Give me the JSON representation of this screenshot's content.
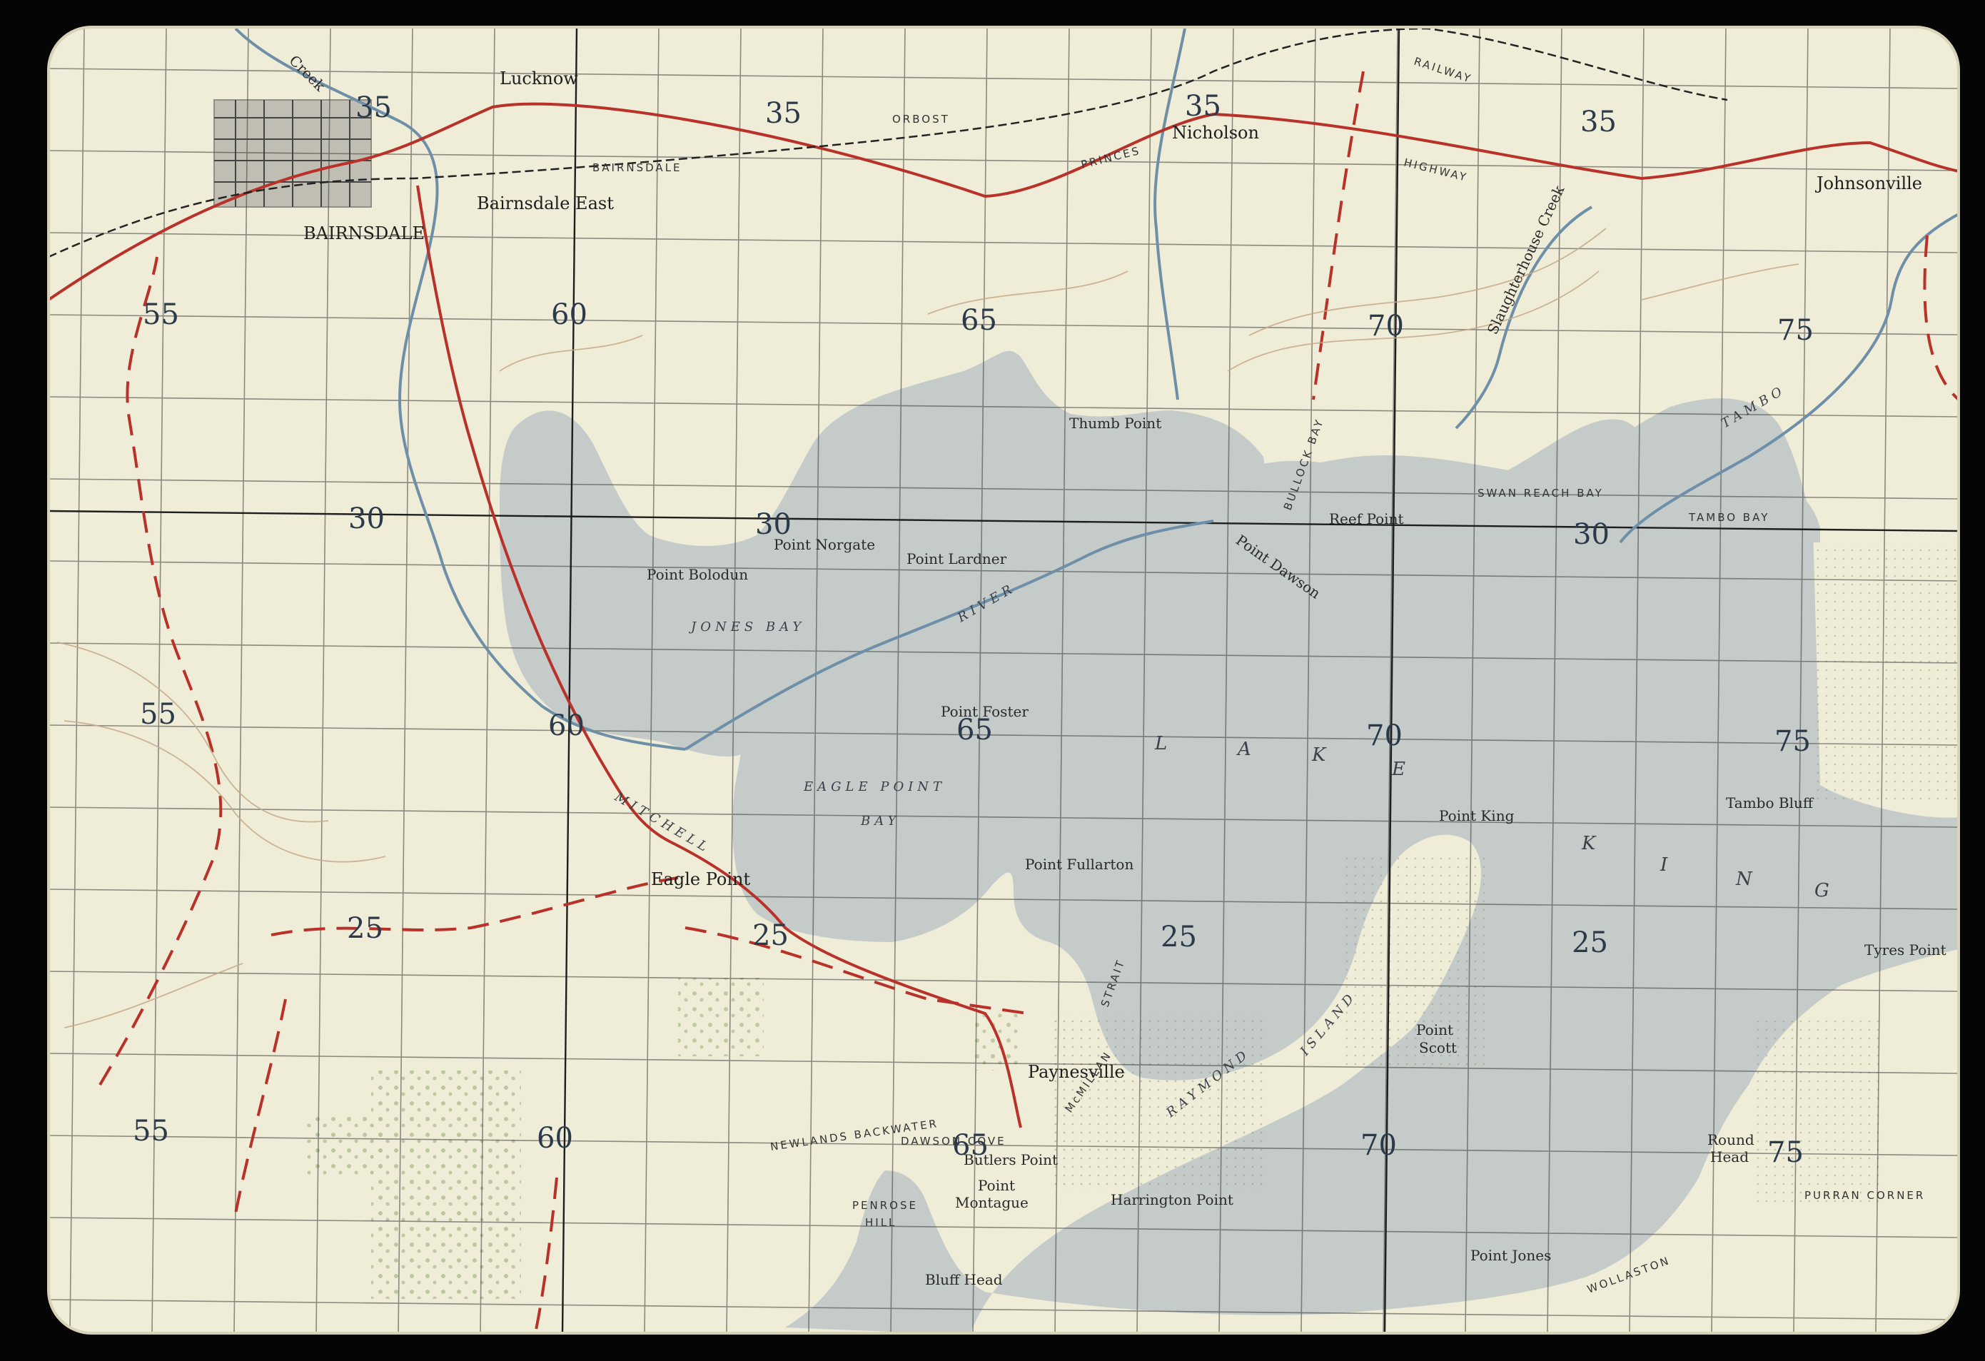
{
  "map": {
    "colors": {
      "paper": "#efecd7",
      "water": "#c4cbc9",
      "grid": "#3a3a3a",
      "road": "#b8322a",
      "contour": "#c7a98a",
      "vegetation": "#b8c49a"
    },
    "towns": {
      "lucknow": "Lucknow",
      "bairnsdale": "BAIRNSDALE",
      "bairnsdale_east": "Bairnsdale East",
      "nicholson": "Nicholson",
      "johnsonville": "Johnsonville",
      "eagle_point": "Eagle Point",
      "paynesville": "Paynesville"
    },
    "places": {
      "thumb_point": "Thumb Point",
      "point_norgate": "Point Norgate",
      "point_bolodun": "Point Bolodun",
      "point_lardner": "Point Lardner",
      "point_dawson": "Point Dawson",
      "reef_point": "Reef Point",
      "point_foster": "Point Foster",
      "point_fullarton": "Point Fullarton",
      "point_king": "Point King",
      "tambo_bluff": "Tambo Bluff",
      "tyres_point": "Tyres Point",
      "point_scott_1": "Point",
      "point_scott_2": "Scott",
      "round_head_1": "Round",
      "round_head_2": "Head",
      "butlers_point": "Butlers Point",
      "point_montague_1": "Point",
      "point_montague_2": "Montague",
      "harrington_point": "Harrington Point",
      "point_jones": "Point Jones",
      "bluff_head": "Bluff Head",
      "penrose_hill_1": "PENROSE",
      "penrose_hill_2": "HILL",
      "newlands_backwater": "NEWLANDS  BACKWATER",
      "dawson_cove": "DAWSON COVE",
      "purran_corner": "PURRAN CORNER",
      "wollaston": "WOLLASTON"
    },
    "water_bodies": {
      "jones_bay": "JONES   BAY",
      "eagle_point_1": "EAGLE    POINT",
      "eagle_point_2": "BAY",
      "swan_reach_bay": "SWAN  REACH  BAY",
      "tambo_bay": "TAMBO  BAY",
      "lake_king_letters": [
        "L",
        "A",
        "K",
        "E",
        "K",
        "I",
        "N",
        "G"
      ],
      "mitchell": "MITCHELL",
      "river": "RIVER",
      "tambo": "TAMBO",
      "creek": "Creek",
      "slaughterhouse_creek": "Slaughterhouse Creek",
      "straits": "STRAIT",
      "mcmillan": "McMILLAN",
      "bullock_bay": "BULLOCK BAY"
    },
    "roads": {
      "princes": "PRINCES",
      "highway": "HIGHWAY",
      "bairnsdale_rd": "BAIRNSDALE",
      "orbost": "ORBOST",
      "railway": "RAILWAY"
    },
    "islands": {
      "raymond": "RAYMOND",
      "island": "ISLAND"
    },
    "grid_labels": {
      "row_35": [
        "35",
        "35",
        "35",
        "35"
      ],
      "row_30": [
        "30",
        "30",
        "30"
      ],
      "row_25": [
        "25",
        "25",
        "25",
        "25"
      ],
      "col_55": [
        "55",
        "55",
        "55"
      ],
      "col_60": [
        "60",
        "60",
        "60"
      ],
      "col_65": [
        "65",
        "65",
        "65"
      ],
      "col_70": [
        "70",
        "70",
        "70"
      ],
      "col_75": [
        "75",
        "75",
        "75"
      ]
    }
  }
}
